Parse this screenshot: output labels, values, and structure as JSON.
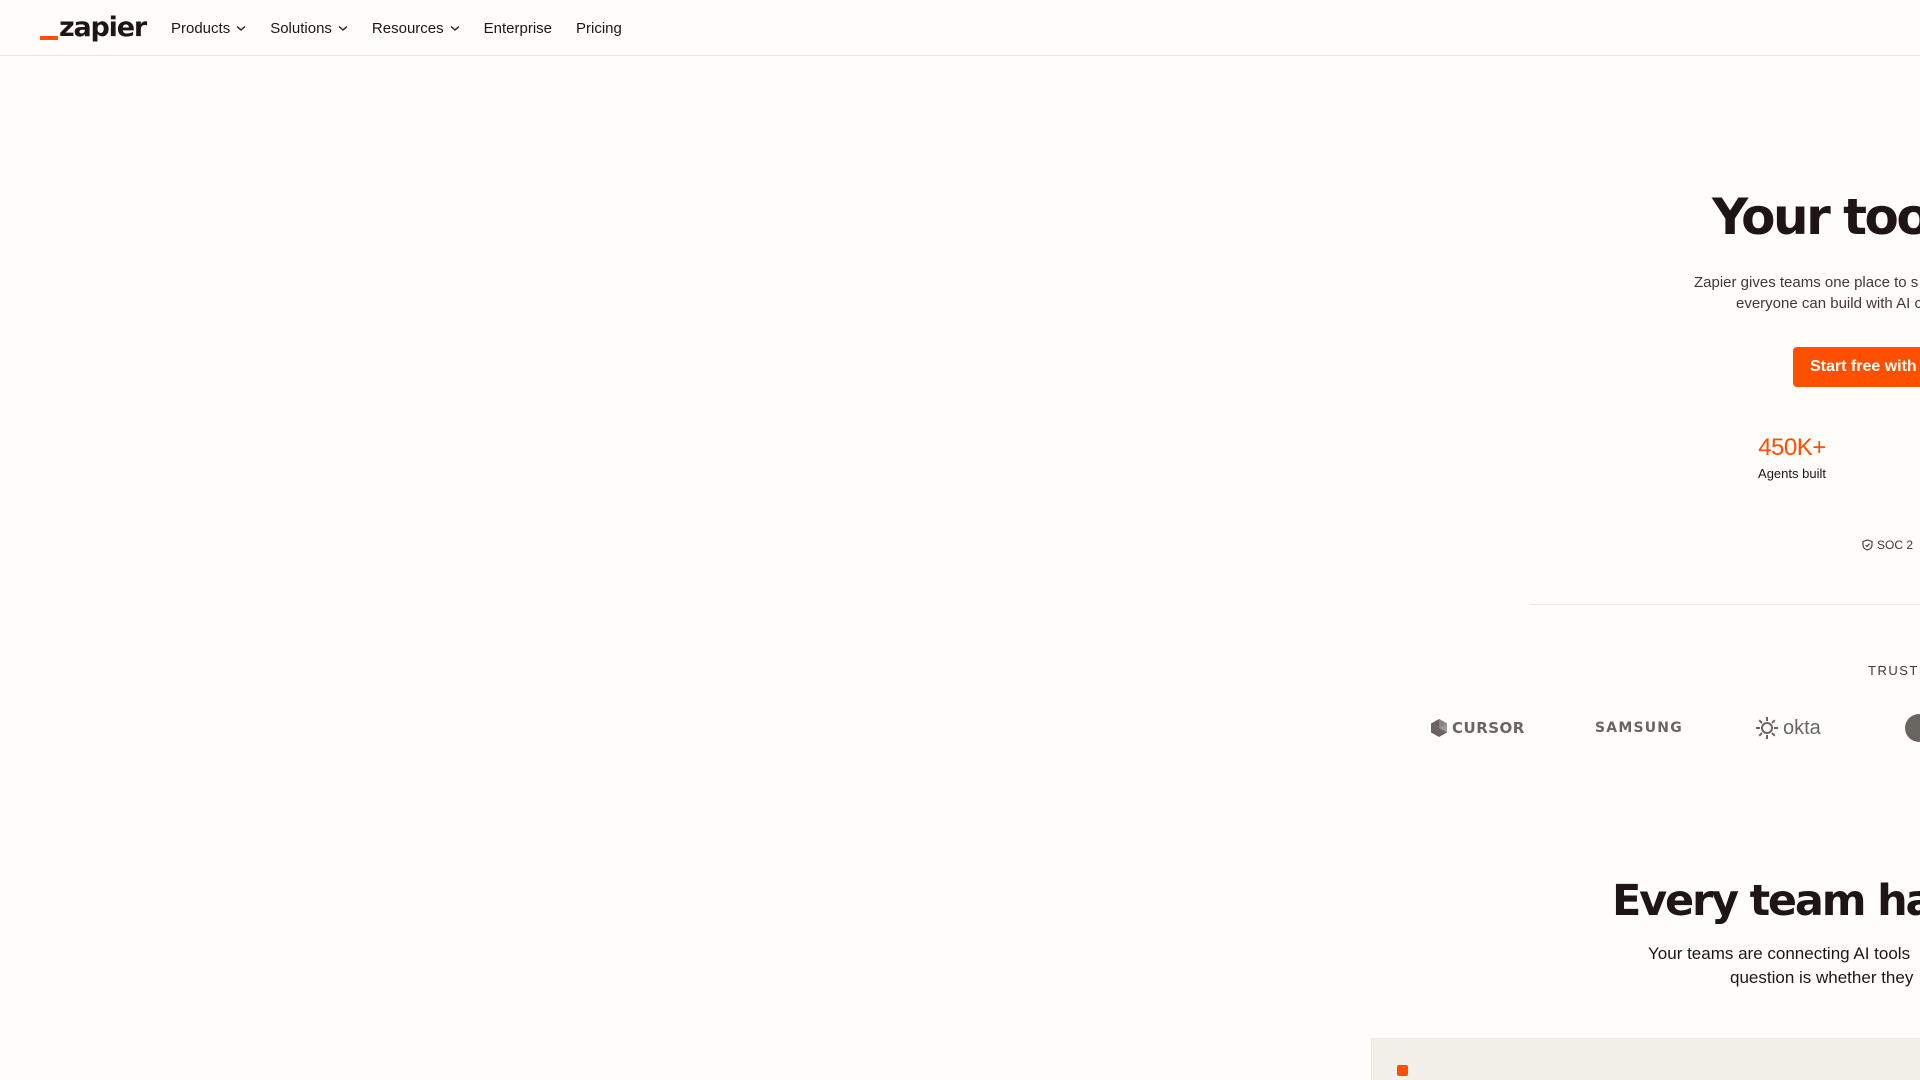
{
  "nav": {
    "logo_text": "zapier",
    "items": [
      {
        "label": "Products",
        "has_dropdown": true
      },
      {
        "label": "Solutions",
        "has_dropdown": true
      },
      {
        "label": "Resources",
        "has_dropdown": true
      },
      {
        "label": "Enterprise",
        "has_dropdown": false
      },
      {
        "label": "Pricing",
        "has_dropdown": false
      }
    ]
  },
  "hero": {
    "title": "Your tools",
    "subtitle_line1": "Zapier gives teams one place to s",
    "subtitle_line2": "everyone can build with AI c",
    "cta_label": "Start free with",
    "stat_value": "450K+",
    "stat_label": "Agents built",
    "badge": "SOC 2"
  },
  "trusted": {
    "label": "TRUSTE",
    "logos": [
      {
        "name": "CURSOR",
        "icon": "cursor-icon"
      },
      {
        "name": "SAMSUNG",
        "icon": "samsung-wordmark"
      },
      {
        "name": "okta",
        "icon": "okta-sunburst-icon"
      },
      {
        "name": "",
        "icon": "circle-logo-icon"
      }
    ]
  },
  "section": {
    "title": "Every team has A",
    "subtitle_line1": "Your teams are connecting AI tools",
    "subtitle_line2": "question is whether they"
  },
  "colors": {
    "accent": "#ff4f00",
    "background": "#fffdf9",
    "text": "#201515",
    "muted_logo": "#6b6562",
    "panel": "#f3efe9"
  }
}
